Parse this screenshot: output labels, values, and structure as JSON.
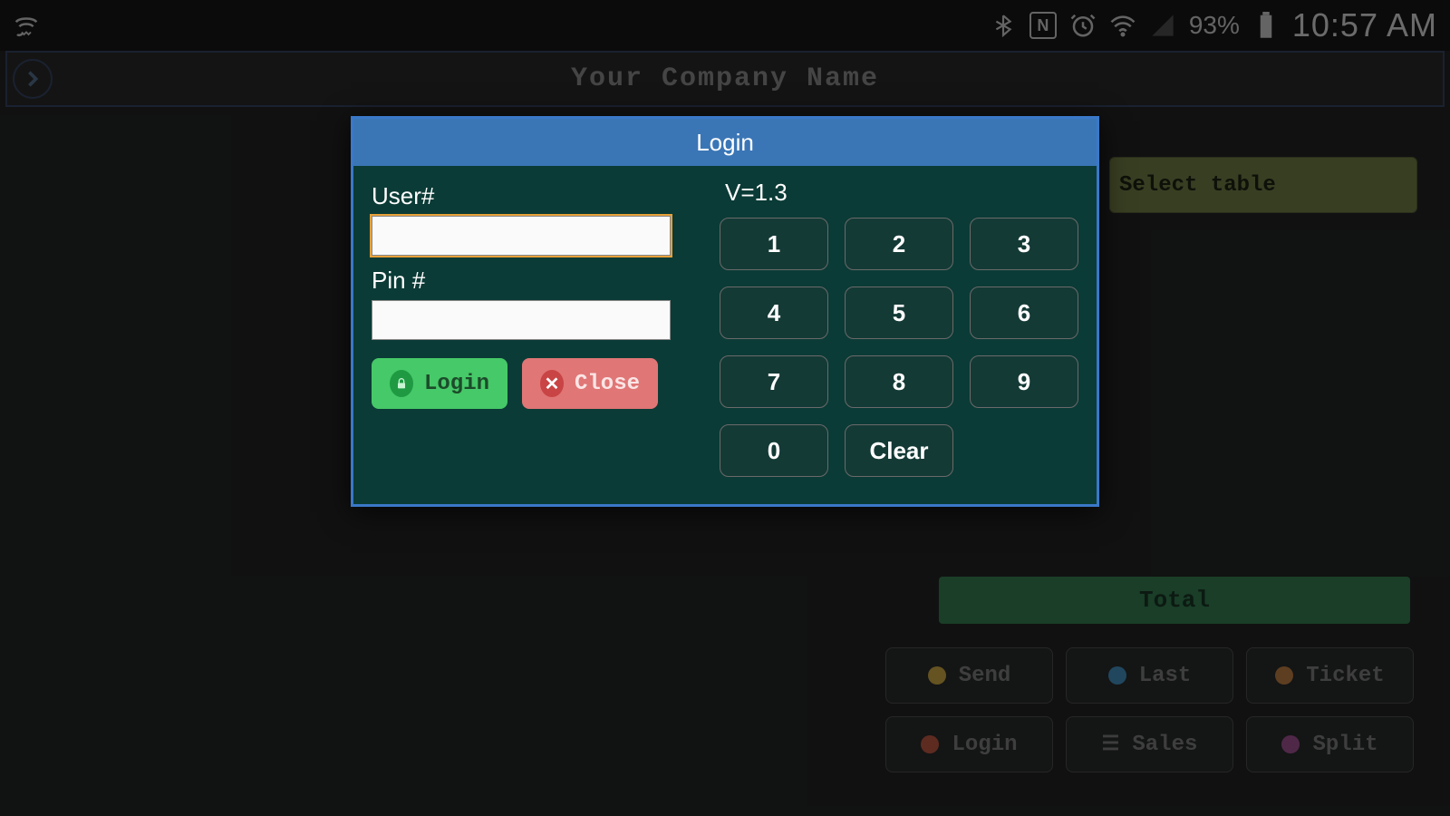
{
  "status": {
    "battery_pct": "93%",
    "clock": "10:57 AM"
  },
  "app": {
    "title": "Your Company Name"
  },
  "bg": {
    "select_table": "Select table",
    "total": "Total",
    "fn": {
      "send": "Send",
      "last": "Last",
      "ticket": "Ticket",
      "login": "Login",
      "sales": "Sales",
      "split": "Split"
    }
  },
  "modal": {
    "title": "Login",
    "user_label": "User#",
    "pin_label": "Pin #",
    "user_value": "",
    "pin_value": "",
    "login_label": "Login",
    "close_label": "Close",
    "version": "V=1.3",
    "keys": {
      "k1": "1",
      "k2": "2",
      "k3": "3",
      "k4": "4",
      "k5": "5",
      "k6": "6",
      "k7": "7",
      "k8": "8",
      "k9": "9",
      "k0": "0",
      "clear": "Clear"
    }
  }
}
